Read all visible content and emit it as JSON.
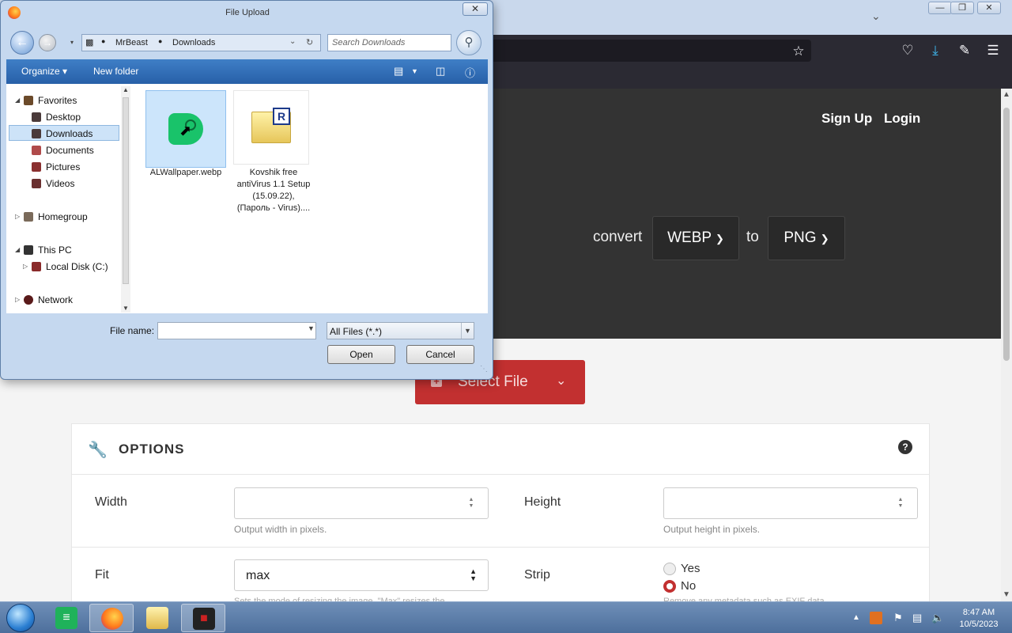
{
  "dialog": {
    "title": "File Upload",
    "close_glyph": "✕",
    "breadcrumb": [
      "MrBeast",
      "Downloads"
    ],
    "search_placeholder": "Search Downloads",
    "commands": {
      "organize": "Organize ▾",
      "new_folder": "New folder"
    },
    "nav": {
      "favorites": "Favorites",
      "desktop": "Desktop",
      "downloads": "Downloads",
      "documents": "Documents",
      "pictures": "Pictures",
      "videos": "Videos",
      "homegroup": "Homegroup",
      "this_pc": "This PC",
      "local_disk": "Local Disk (C:)",
      "network": "Network"
    },
    "files": [
      {
        "name": "ALWallpaper.webp",
        "icon": "wallpaper-app-icon",
        "selected": true
      },
      {
        "name_lines": [
          "Kovshik free",
          "antiVirus 1.1 Setup",
          "(15.09.22),",
          "(Пароль - Virus)...."
        ],
        "icon": "installer-archive-icon",
        "selected": false
      }
    ],
    "file_name_label": "File name:",
    "file_name_value": "",
    "filter_value": "All Files (*.*)",
    "open_button": "Open",
    "cancel_button": "Cancel"
  },
  "page": {
    "signup": "Sign Up",
    "login": "Login",
    "convert_word": "convert",
    "from_format": "WEBP",
    "to_word": "to",
    "to_format": "PNG",
    "select_file": "Select File",
    "options_title": "OPTIONS",
    "width_label": "Width",
    "width_hint": "Output width in pixels.",
    "height_label": "Height",
    "height_hint": "Output height in pixels.",
    "fit_label": "Fit",
    "fit_value": "max",
    "fit_hint": "Sets the mode of resizing the image. \"Max\" resizes the",
    "strip_label": "Strip",
    "strip_yes": "Yes",
    "strip_no": "No",
    "strip_selected": "No",
    "strip_hint": "Remove any metadata such as EXIF data."
  },
  "taskbar": {
    "time": "8:47 AM",
    "date": "10/5/2023"
  },
  "colors": {
    "accent_red": "#c23030",
    "hero_bg": "#333333",
    "dialog_bar": "#2760a8"
  }
}
